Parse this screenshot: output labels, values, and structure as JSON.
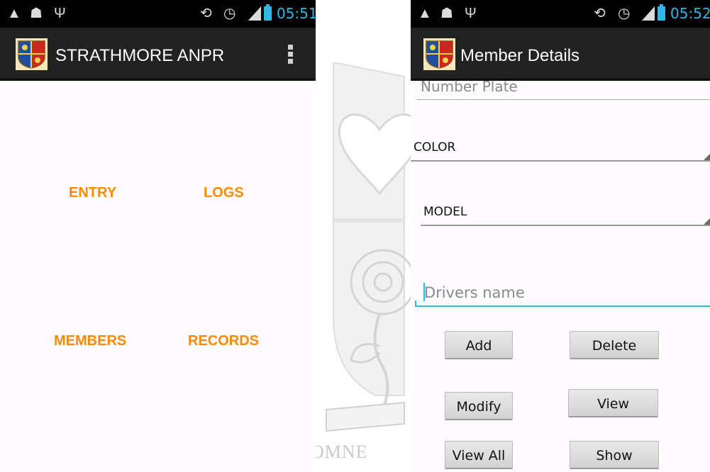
{
  "left_screen": {
    "status_bar": {
      "time": "05:51"
    },
    "action_bar": {
      "title": "STRATHMORE ANPR"
    },
    "menu": {
      "entry": "ENTRY",
      "logs": "LOGS",
      "members": "MEMBERS",
      "records": "RECORDS"
    }
  },
  "right_screen": {
    "status_bar": {
      "time": "05:52"
    },
    "action_bar": {
      "title": "Member Details"
    },
    "form": {
      "number_plate_placeholder": "Number Plate",
      "color_spinner": "COLOR",
      "model_spinner": "MODEL",
      "drivers_name_placeholder": "Drivers name"
    },
    "buttons": {
      "add": "Add",
      "delete": "Delete",
      "modify": "Modify",
      "view": "View",
      "view_all": "View All",
      "show": "Show"
    }
  },
  "watermark": {
    "motto_fragment": "OMNE"
  },
  "colors": {
    "accent_orange": "#ff8a00",
    "holo_blue": "#33b5e5",
    "action_bar": "#222222",
    "status_bar": "#000000"
  },
  "icons": {
    "status_left": [
      "warning-icon",
      "android-debug-icon",
      "usb-icon"
    ],
    "status_right": [
      "rotation-icon",
      "alarm-icon",
      "signal-icon",
      "battery-charging-icon"
    ],
    "action_bar": [
      "crest-logo-icon",
      "overflow-menu-icon"
    ]
  }
}
